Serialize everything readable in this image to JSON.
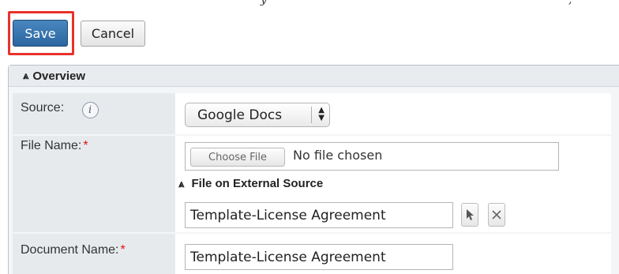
{
  "actions": {
    "save_label": "Save",
    "cancel_label": "Cancel"
  },
  "panel": {
    "title": "Overview",
    "fields": {
      "source": {
        "label": "Source:",
        "info_icon": "info-icon",
        "selected": "Google Docs"
      },
      "file_name": {
        "label": "File Name:",
        "required_marker": "*",
        "choose_file_label": "Choose File",
        "file_status": "No file chosen"
      },
      "external_source": {
        "title": "File on External Source",
        "value": "Template-License Agreement",
        "select_icon": "cursor-arrow-icon",
        "clear_icon": "close-x-icon"
      },
      "document_name": {
        "label": "Document Name:",
        "required_marker": "*",
        "value": "Template-License Agreement"
      }
    }
  },
  "colors": {
    "save_button": "#2f6ea8",
    "highlight": "#e8322b",
    "required": "#dd1111"
  }
}
